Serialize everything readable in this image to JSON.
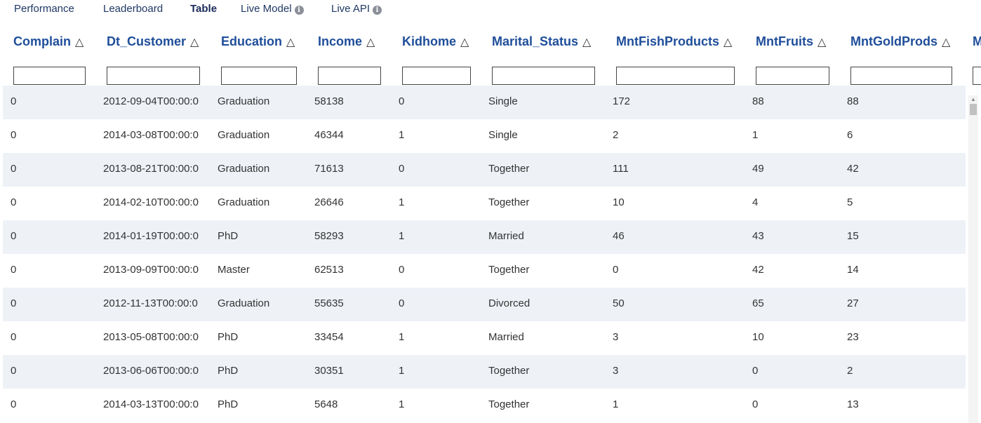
{
  "tabs": [
    {
      "label": "Performance"
    },
    {
      "label": "Leaderboard"
    },
    {
      "label": "Table",
      "active": true
    },
    {
      "label": "Live Model",
      "info": true
    },
    {
      "label": "Live API",
      "info": true
    }
  ],
  "table": {
    "sort_glyph": "△",
    "columns": [
      "Complain",
      "Dt_Customer",
      "Education",
      "Income",
      "Kidhome",
      "Marital_Status",
      "MntFishProducts",
      "MntFruits",
      "MntGoldProds",
      "M"
    ],
    "filters": [
      "",
      "",
      "",
      "",
      "",
      "",
      "",
      "",
      "",
      ""
    ],
    "rows": [
      [
        "0",
        "2012-09-04T00:00:0",
        "Graduation",
        "58138",
        "0",
        "Single",
        "172",
        "88",
        "88"
      ],
      [
        "0",
        "2014-03-08T00:00:0",
        "Graduation",
        "46344",
        "1",
        "Single",
        "2",
        "1",
        "6"
      ],
      [
        "0",
        "2013-08-21T00:00:0",
        "Graduation",
        "71613",
        "0",
        "Together",
        "111",
        "49",
        "42"
      ],
      [
        "0",
        "2014-02-10T00:00:0",
        "Graduation",
        "26646",
        "1",
        "Together",
        "10",
        "4",
        "5"
      ],
      [
        "0",
        "2014-01-19T00:00:0",
        "PhD",
        "58293",
        "1",
        "Married",
        "46",
        "43",
        "15"
      ],
      [
        "0",
        "2013-09-09T00:00:0",
        "Master",
        "62513",
        "0",
        "Together",
        "0",
        "42",
        "14"
      ],
      [
        "0",
        "2012-11-13T00:00:0",
        "Graduation",
        "55635",
        "0",
        "Divorced",
        "50",
        "65",
        "27"
      ],
      [
        "0",
        "2013-05-08T00:00:0",
        "PhD",
        "33454",
        "1",
        "Married",
        "3",
        "10",
        "23"
      ],
      [
        "0",
        "2013-06-06T00:00:0",
        "PhD",
        "30351",
        "1",
        "Together",
        "3",
        "0",
        "2"
      ],
      [
        "0",
        "2014-03-13T00:00:0",
        "PhD",
        "5648",
        "1",
        "Together",
        "1",
        "0",
        "13"
      ]
    ]
  },
  "info_icon_glyph": "i",
  "colors": {
    "header_text": "#1f4e9a",
    "stripe": "#eef2f7"
  }
}
